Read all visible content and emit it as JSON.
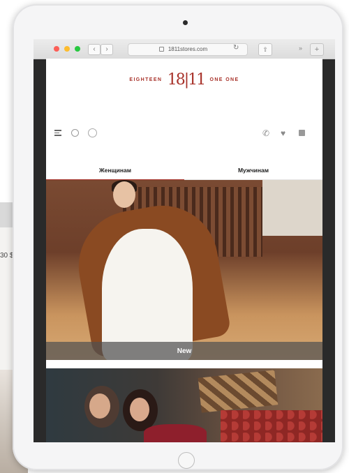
{
  "background_page": {
    "partial_text": "30 $"
  },
  "browser": {
    "url": "1811stores.com",
    "back_label": "‹",
    "forward_label": "›",
    "share_label": "⇧",
    "more_label": "»",
    "new_tab_label": "+"
  },
  "site": {
    "logo_left": "EIGHTEEN",
    "logo_mark": "18|11",
    "logo_right": "ONE ONE",
    "brand_color": "#a8322a"
  },
  "header_icons": [
    "menu-icon",
    "search-icon",
    "whatsapp-icon",
    "phone-icon",
    "heart-icon",
    "cart-icon"
  ],
  "tabs": [
    {
      "label": "Женщинам",
      "active": true
    },
    {
      "label": "Мужчинам",
      "active": false
    }
  ],
  "hero": {
    "banner_label": "New"
  }
}
